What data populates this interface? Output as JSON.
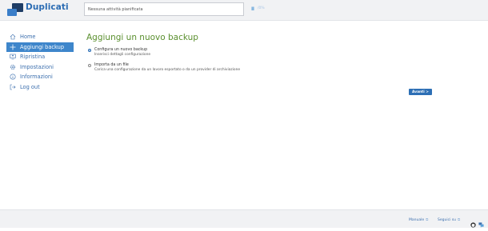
{
  "header": {
    "app_name": "Duplicati",
    "status_text": "Nessuna attività pianificata",
    "pause_label": "II",
    "speed_text": "/0%"
  },
  "sidebar": {
    "items": [
      {
        "label": "Home",
        "icon": "home-icon"
      },
      {
        "label": "Aggiungi backup",
        "icon": "plus-icon",
        "active": true
      },
      {
        "label": "Ripristina",
        "icon": "restore-icon"
      },
      {
        "label": "Impostazioni",
        "icon": "gear-icon"
      },
      {
        "label": "Informazioni",
        "icon": "info-icon"
      },
      {
        "label": "Log out",
        "icon": "logout-icon"
      }
    ]
  },
  "main": {
    "title": "Aggiungi un nuovo backup",
    "options": [
      {
        "label": "Configura un nuovo backup",
        "description": "Inserisci dettagli configurazione",
        "selected": true
      },
      {
        "label": "Importa da un file",
        "description": "Carica una configurazione da un lavoro esportato o da un provider di archiviazione",
        "selected": false
      }
    ],
    "next_label": "Avanti >"
  },
  "footer": {
    "manual_label": "Manuale",
    "follow_label": "Seguici su",
    "external_icon": "external-link-icon",
    "social_icons": [
      "github-icon",
      "chat-icon"
    ]
  },
  "colors": {
    "accent": "#3e86cb",
    "title_green": "#5a8f2e",
    "button": "#2d6fb5"
  }
}
